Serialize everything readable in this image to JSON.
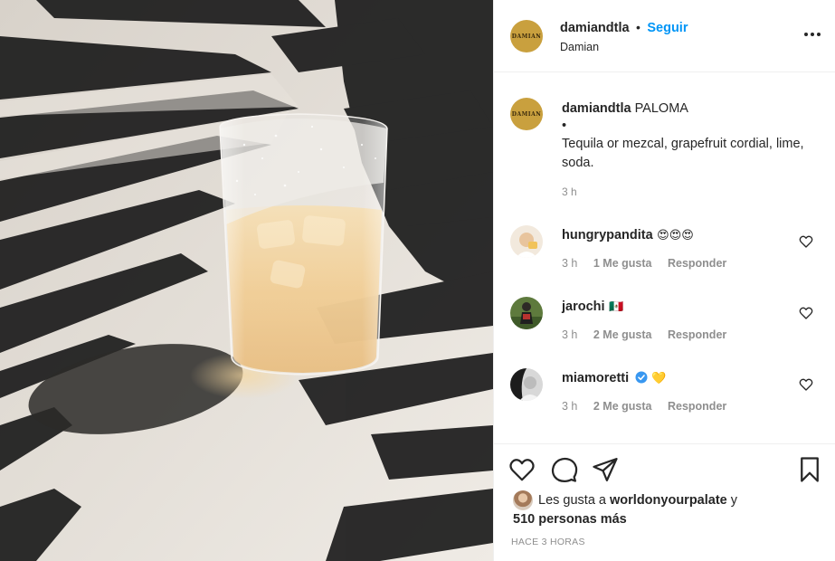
{
  "post": {
    "image_alt": "Paloma cocktail glass with salted rim in palm-leaf shadows"
  },
  "header": {
    "avatar_text": "DAMIAN",
    "username": "damiandtla",
    "separator": "•",
    "follow_label": "Seguir",
    "display_name": "Damian",
    "more_icon": "more-horizontal-icon"
  },
  "caption": {
    "avatar_text": "DAMIAN",
    "username": "damiandtla",
    "title": "PALOMA",
    "bullet": "•",
    "body": "Tequila or mezcal, grapefruit cordial, lime, soda.",
    "time": "3 h"
  },
  "comments": [
    {
      "username": "hungrypandita",
      "text": "😍😍😍",
      "time": "3 h",
      "likes": "1 Me gusta",
      "reply": "Responder"
    },
    {
      "username": "jarochi",
      "text": "🇲🇽",
      "time": "3 h",
      "likes": "2 Me gusta",
      "reply": "Responder"
    },
    {
      "username": "miamoretti",
      "text": "💛",
      "time": "3 h",
      "likes": "2 Me gusta",
      "reply": "Responder",
      "verified": true
    }
  ],
  "actions": {
    "like_icon": "heart-icon",
    "comment_icon": "comment-icon",
    "share_icon": "send-icon",
    "save_icon": "bookmark-icon"
  },
  "likes": {
    "prefix": "Les gusta a",
    "user": "worldonyourpalate",
    "conj": "y",
    "others": "510 personas más"
  },
  "footer": {
    "time": "HACE 3 HORAS"
  },
  "colors": {
    "link_blue": "#0095f6",
    "text": "#262626",
    "muted": "#8e8e8e",
    "border": "#efefef",
    "brand_gold": "#c9a03e",
    "verified_blue": "#3897f0"
  }
}
